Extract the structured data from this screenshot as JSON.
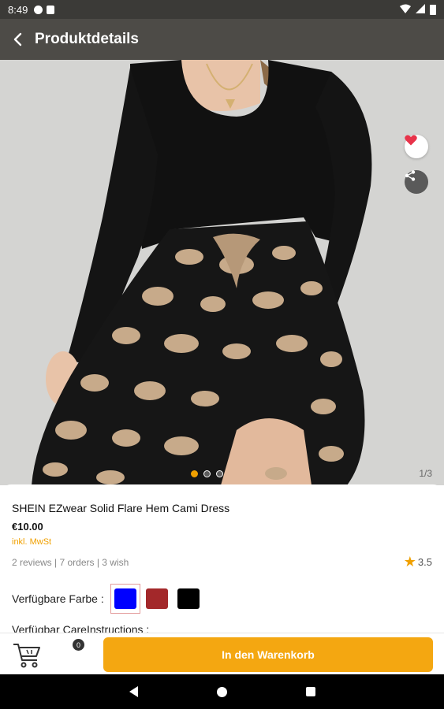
{
  "status_bar": {
    "time": "8:49"
  },
  "app_bar": {
    "title": "Produktdetails"
  },
  "gallery": {
    "counter": "1/3",
    "dots": 3,
    "active_index": 0
  },
  "product": {
    "title": "SHEIN EZwear Solid Flare Hem Cami Dress",
    "price": "€10.00",
    "tax_note": "inkl. MwSt",
    "stats": "2 reviews | 7 orders | 3 wish",
    "rating": "3.5"
  },
  "colors": {
    "label": "Verfügbare Farbe :",
    "options": [
      {
        "name": "blue",
        "hex": "#0000ff",
        "selected": true
      },
      {
        "name": "red",
        "hex": "#a3282a",
        "selected": false
      },
      {
        "name": "black",
        "hex": "#000000",
        "selected": false
      }
    ]
  },
  "care": {
    "label": "Verfügbar CareInstructions :"
  },
  "cart": {
    "count": "0",
    "add_label": "In den Warenkorb"
  },
  "theme": {
    "accent": "#f4a711",
    "app_bar": "#4d4b47"
  }
}
